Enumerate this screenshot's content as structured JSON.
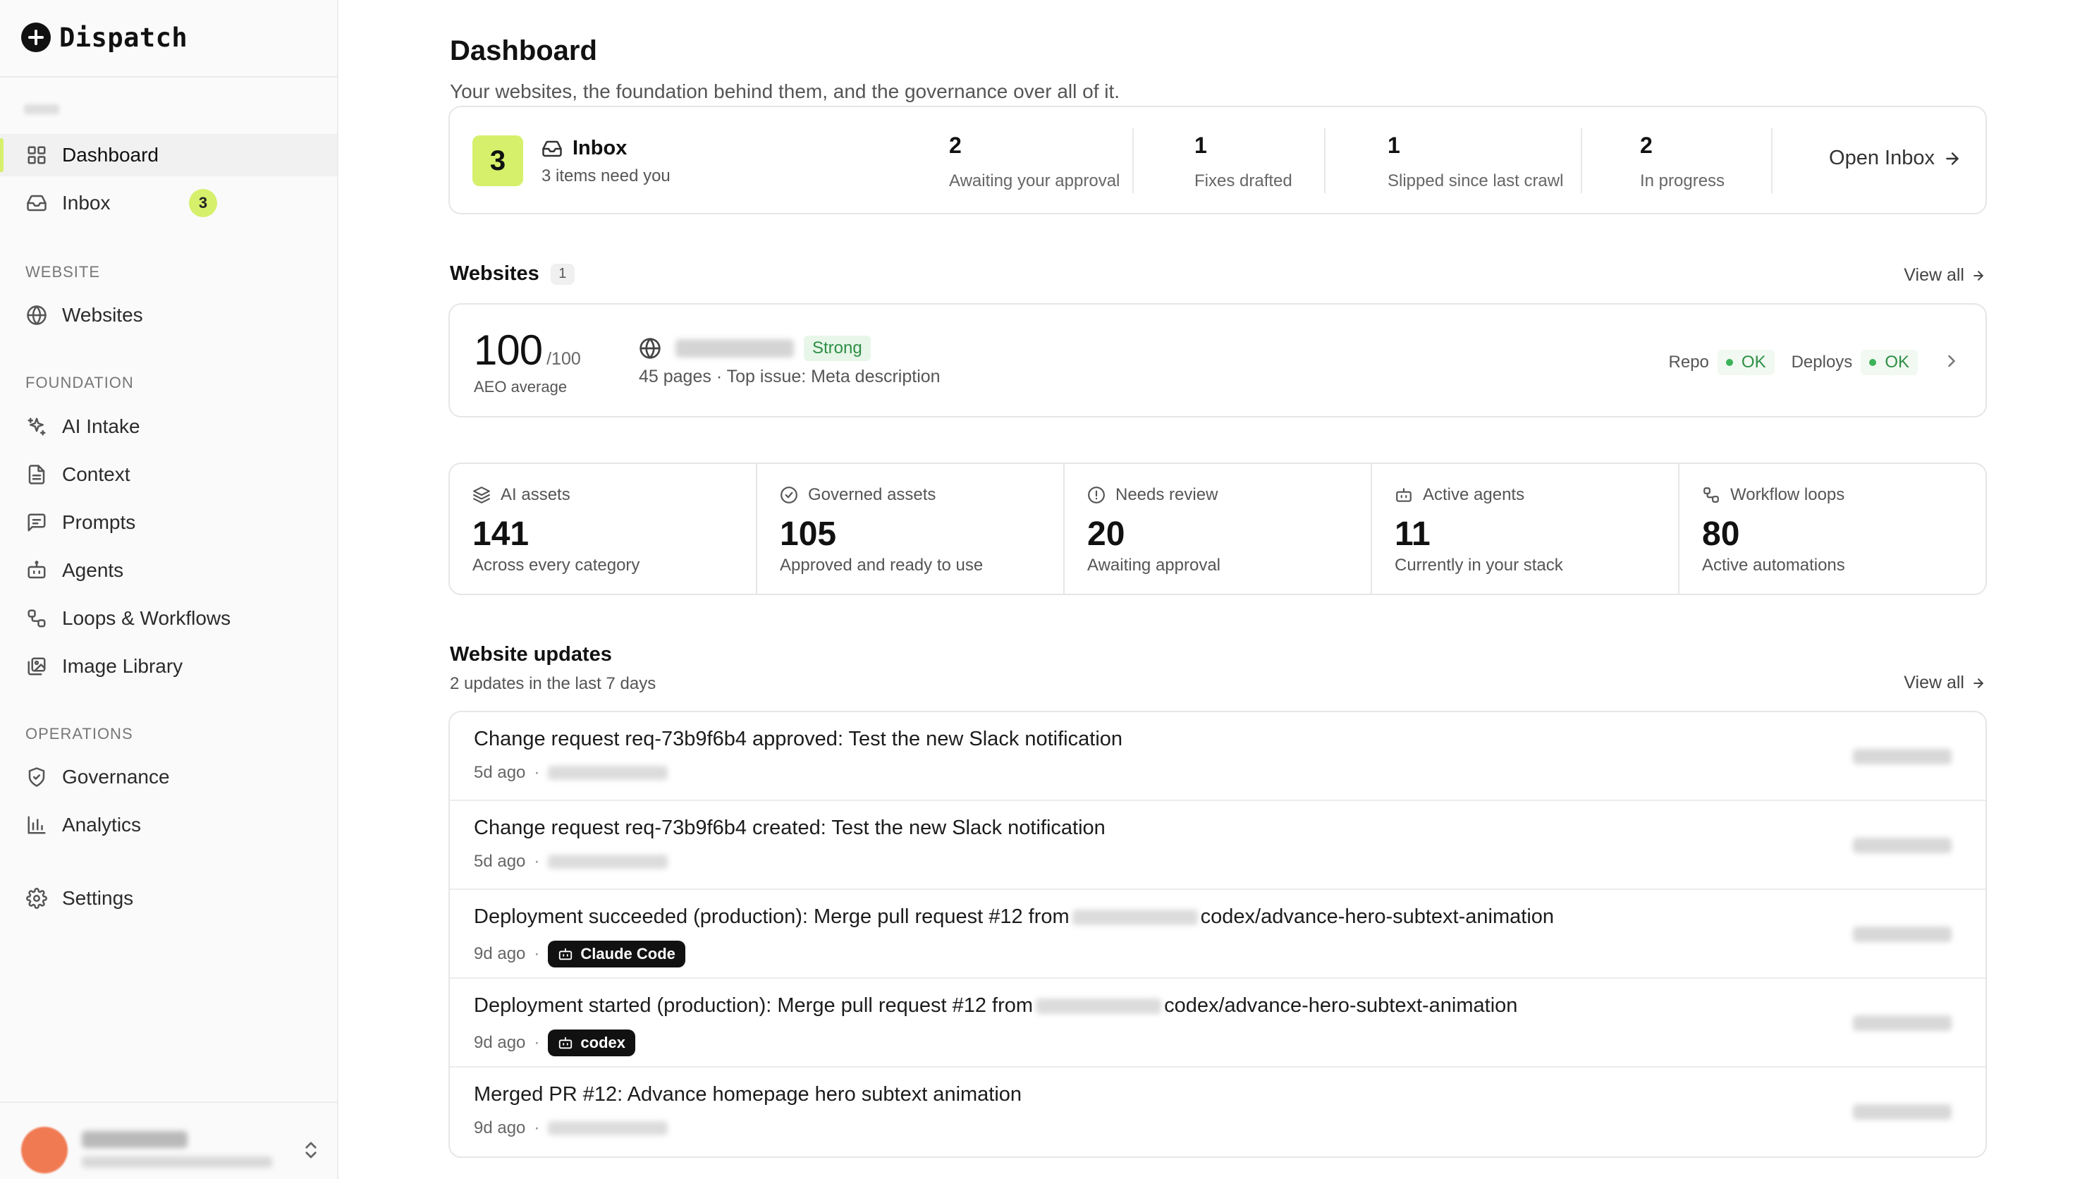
{
  "app": {
    "name": "Dispatch"
  },
  "sidebar": {
    "items": [
      {
        "label": "Dashboard"
      },
      {
        "label": "Inbox",
        "badge": "3"
      }
    ],
    "sections": {
      "website": {
        "title": "WEBSITE",
        "items": [
          {
            "label": "Websites"
          }
        ]
      },
      "foundation": {
        "title": "FOUNDATION",
        "items": [
          {
            "label": "AI Intake"
          },
          {
            "label": "Context"
          },
          {
            "label": "Prompts"
          },
          {
            "label": "Agents"
          },
          {
            "label": "Loops & Workflows"
          },
          {
            "label": "Image Library"
          }
        ]
      },
      "operations": {
        "title": "OPERATIONS",
        "items": [
          {
            "label": "Governance"
          },
          {
            "label": "Analytics"
          }
        ]
      }
    },
    "settings": {
      "label": "Settings"
    }
  },
  "main": {
    "title": "Dashboard",
    "subtitle": "Your websites, the foundation behind them, and the governance over all of it.",
    "inbox": {
      "count": "3",
      "title": "Inbox",
      "subtitle": "3 items need you",
      "stats": [
        {
          "value": "2",
          "label": "Awaiting your approval"
        },
        {
          "value": "1",
          "label": "Fixes drafted"
        },
        {
          "value": "1",
          "label": "Slipped since last crawl"
        },
        {
          "value": "2",
          "label": "In progress"
        }
      ],
      "open_label": "Open Inbox"
    },
    "websites": {
      "title": "Websites",
      "count": "1",
      "view_all": "View all",
      "card": {
        "score": "100",
        "score_max": "/100",
        "score_label": "AEO average",
        "strength": "Strong",
        "meta": "45 pages · Top issue: Meta description",
        "repo_label": "Repo",
        "repo_status": "OK",
        "deploys_label": "Deploys",
        "deploys_status": "OK"
      }
    },
    "metrics": [
      {
        "icon": "layers-icon",
        "label": "AI assets",
        "value": "141",
        "desc": "Across every category"
      },
      {
        "icon": "check-circle-icon",
        "label": "Governed assets",
        "value": "105",
        "desc": "Approved and ready to use"
      },
      {
        "icon": "alert-circle-icon",
        "label": "Needs review",
        "value": "20",
        "desc": "Awaiting approval"
      },
      {
        "icon": "bot-icon",
        "label": "Active agents",
        "value": "11",
        "desc": "Currently in your stack"
      },
      {
        "icon": "workflow-icon",
        "label": "Workflow loops",
        "value": "80",
        "desc": "Active automations"
      }
    ],
    "updates": {
      "title": "Website updates",
      "subtitle": "2 updates in the last 7 days",
      "view_all": "View all",
      "items": [
        {
          "title": "Change request req-73b9f6b4 approved: Test the new Slack notification",
          "time": "5d ago"
        },
        {
          "title": "Change request req-73b9f6b4 created: Test the new Slack notification",
          "time": "5d ago"
        },
        {
          "title_prefix": "Deployment succeeded (production): Merge pull request #12 from",
          "title_suffix": "codex/advance-hero-subtext-animation",
          "time": "9d ago",
          "agent": "Claude Code"
        },
        {
          "title_prefix": "Deployment started (production): Merge pull request #12 from",
          "title_suffix": "codex/advance-hero-subtext-animation",
          "time": "9d ago",
          "agent": "codex"
        },
        {
          "title": "Merged PR #12: Advance homepage hero subtext animation",
          "time": "9d ago"
        }
      ]
    }
  },
  "colors": {
    "accent": "#d6f06b",
    "ok_green": "#2e8f45",
    "ok_bg": "#f1f9f2"
  }
}
